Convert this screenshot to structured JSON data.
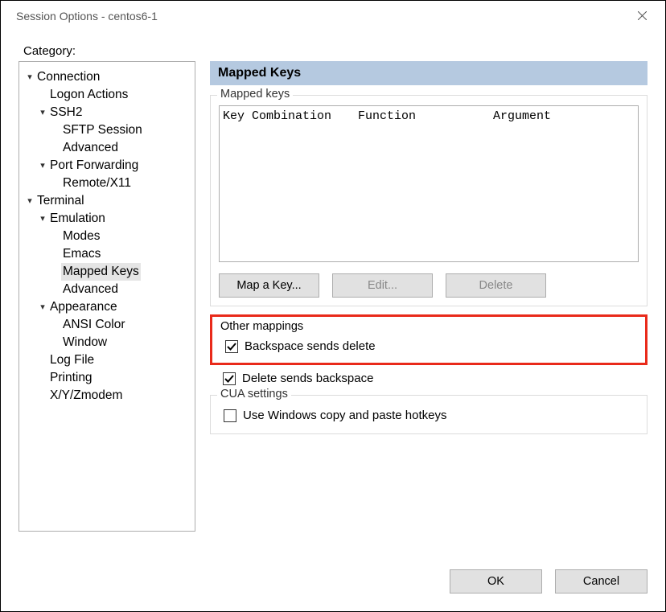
{
  "window": {
    "title": "Session Options - centos6-1"
  },
  "category_label": "Category:",
  "tree": {
    "connection": "Connection",
    "logon": "Logon Actions",
    "ssh2": "SSH2",
    "sftp": "SFTP Session",
    "ssh_adv": "Advanced",
    "portfwd": "Port Forwarding",
    "remotex11": "Remote/X11",
    "terminal": "Terminal",
    "emulation": "Emulation",
    "modes": "Modes",
    "emacs": "Emacs",
    "mapped_keys": "Mapped Keys",
    "emu_adv": "Advanced",
    "appearance": "Appearance",
    "ansi": "ANSI Color",
    "window": "Window",
    "logfile": "Log File",
    "printing": "Printing",
    "xyz": "X/Y/Zmodem"
  },
  "page": {
    "title": "Mapped Keys",
    "mapped_keys_legend": "Mapped keys",
    "columns": {
      "key": "Key Combination",
      "func": "Function",
      "arg": "Argument"
    },
    "buttons": {
      "map": "Map a Key...",
      "edit": "Edit...",
      "del": "Delete"
    },
    "other_legend": "Other mappings",
    "backspace_sends_delete": {
      "label": "Backspace sends delete",
      "checked": true
    },
    "delete_sends_backspace": {
      "label": "Delete sends backspace",
      "checked": true
    },
    "cua_legend": "CUA settings",
    "use_windows_hotkeys": {
      "label": "Use Windows copy and paste hotkeys",
      "checked": false
    }
  },
  "footer": {
    "ok": "OK",
    "cancel": "Cancel"
  }
}
